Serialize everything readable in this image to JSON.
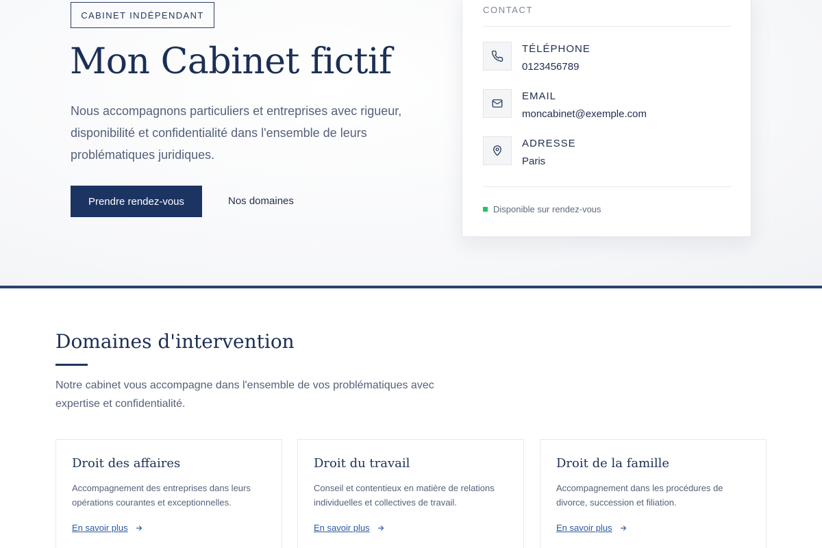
{
  "hero": {
    "badge": "CABINET INDÉPENDANT",
    "title": "Mon Cabinet fictif",
    "text": "Nous accompagnons particuliers et entreprises avec rigueur, disponibilité et confidentialité dans l'ensemble de leurs problématiques juridiques.",
    "primary_button": "Prendre rendez-vous",
    "secondary_link": "Nos domaines"
  },
  "contact": {
    "heading": "CONTACT",
    "items": [
      {
        "label": "TÉLÉPHONE",
        "value": "0123456789",
        "icon": "phone-icon"
      },
      {
        "label": "EMAIL",
        "value": "moncabinet@exemple.com",
        "icon": "mail-icon"
      },
      {
        "label": "ADRESSE",
        "value": "Paris",
        "icon": "location-pin-icon"
      }
    ],
    "status": "Disponible sur rendez-vous",
    "status_color": "#22c55e"
  },
  "domains": {
    "title": "Domaines d'intervention",
    "text": "Notre cabinet vous accompagne dans l'ensemble de vos problématiques avec expertise et confidentialité.",
    "cards": [
      {
        "title": "Droit des affaires",
        "description": "Accompagnement des entreprises dans leurs opérations courantes et exceptionnelles.",
        "link": "En savoir plus"
      },
      {
        "title": "Droit du travail",
        "description": "Conseil et contentieux en matière de relations individuelles et collectives de travail.",
        "link": "En savoir plus"
      },
      {
        "title": "Droit de la famille",
        "description": "Accompagnement dans les procédures de divorce, succession et filiation.",
        "link": "En savoir plus"
      }
    ]
  },
  "colors": {
    "brand_navy": "#1c3461",
    "link_blue": "#2c5aa0",
    "text_muted": "#55607a"
  }
}
